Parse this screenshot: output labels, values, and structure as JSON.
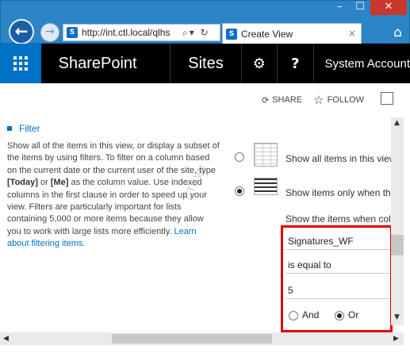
{
  "browser": {
    "window_controls": [
      "–",
      "☐",
      "✕"
    ],
    "address": "http://int.ctl.local/qlhs",
    "address_icons": "⌕▾ ↻",
    "tab_title": "Create View",
    "tab_close": "×",
    "home_icon": "⌂"
  },
  "suitebar": {
    "brand": "SharePoint",
    "sites": "Sites",
    "settings_icon": "⚙",
    "help_icon": "?",
    "account": "System Account"
  },
  "actions": {
    "share": "SHARE",
    "follow": "FOLLOW"
  },
  "filter": {
    "heading": "Filter",
    "desc_1": "Show all of the items in this view, or display a subset of the items by using filters. To filter on a column based on the current date or the current user of the site, type",
    "today": "[Today]",
    "or": "or",
    "me": "[Me]",
    "desc_2": "as the column value. Use indexed columns in the first clause in order to speed up your view. Filters are particularly important for lists containing 5,000 or more items because they allow you to work with large lists more efficiently.",
    "learn_link": "Learn about filtering items.",
    "watermark": "CTL.VN"
  },
  "options": {
    "show_all": "Show all items in this view",
    "show_only": "Show items only when the following is true:",
    "show_when": "Show the items when column"
  },
  "condition": {
    "column": "Signatures_WF",
    "operator": "is equal to",
    "value": "5",
    "and_label": "And",
    "or_label": "Or"
  }
}
